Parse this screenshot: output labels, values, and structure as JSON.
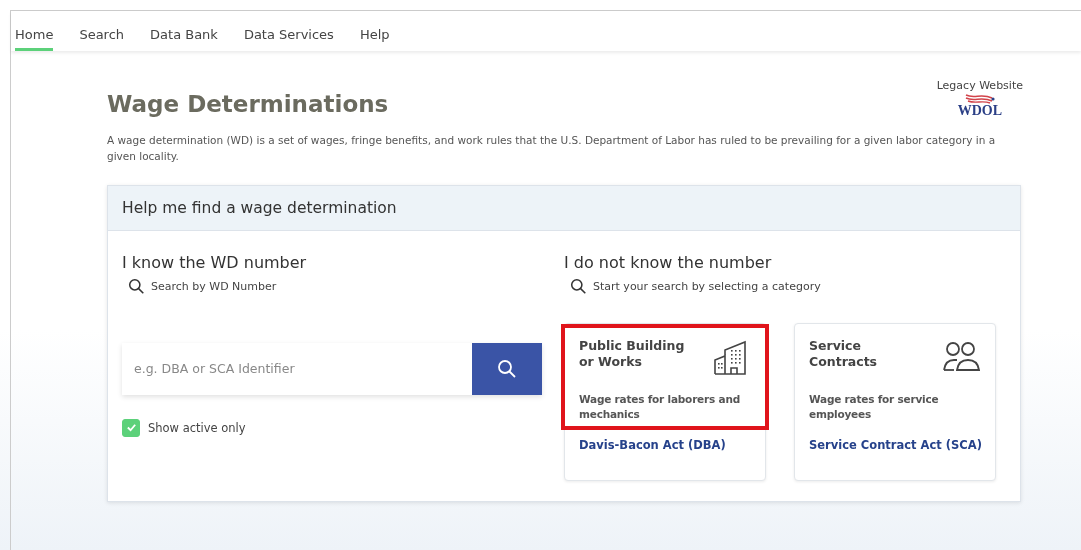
{
  "nav": [
    {
      "label": "Home",
      "selected": true
    },
    {
      "label": "Search",
      "selected": false
    },
    {
      "label": "Data Bank",
      "selected": false
    },
    {
      "label": "Data Services",
      "selected": false
    },
    {
      "label": "Help",
      "selected": false
    }
  ],
  "title": "Wage Determinations",
  "legacy": {
    "label": "Legacy Website",
    "logo": "WDOL"
  },
  "intro": "A wage determination (WD) is a set of wages, fringe benefits, and work rules that the U.S. Department of Labor has ruled to be prevailing for a given labor category in a given locality.",
  "panel": {
    "heading": "Help me find a wage determination",
    "known": {
      "heading": "I know the WD number",
      "hint": "Search by WD Number",
      "placeholder": "e.g. DBA or SCA Identifier",
      "active_only": {
        "label": "Show active only",
        "checked": true
      }
    },
    "unknown": {
      "heading": "I do not know the number",
      "hint": "Start your search by selecting a category",
      "categories": [
        {
          "kind": "building",
          "title": "Public Building or Works",
          "description": "Wage rates for laborers and mechanics",
          "link": "Davis-Bacon Act (DBA)",
          "highlighted": true
        },
        {
          "kind": "people",
          "title": "Service Contracts",
          "description": "Wage rates for service employees",
          "link": "Service Contract Act (SCA)",
          "highlighted": false
        }
      ]
    }
  }
}
